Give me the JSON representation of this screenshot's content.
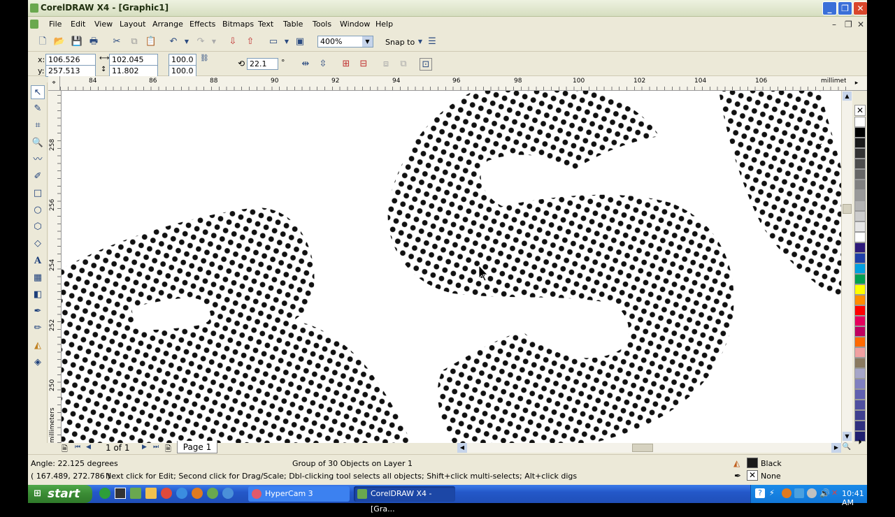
{
  "window": {
    "title": "CorelDRAW X4 - [Graphic1]"
  },
  "menu": [
    "File",
    "Edit",
    "View",
    "Layout",
    "Arrange",
    "Effects",
    "Bitmaps",
    "Text",
    "Table",
    "Tools",
    "Window",
    "Help"
  ],
  "toolbar": {
    "zoom": "400%",
    "snap_to": "Snap to"
  },
  "property_bar": {
    "x_label": "x:",
    "x": "106.526 mm",
    "y_label": "y:",
    "y": "257.513 mm",
    "width": "102.045 mm",
    "height": "11.802 mm",
    "scale_w": "100.0",
    "scale_h": "100.0",
    "angle": "22.1",
    "degree_symbol": "°"
  },
  "rulers": {
    "h_ticks": [
      "84",
      "86",
      "88",
      "90",
      "92",
      "94",
      "96",
      "98",
      "100",
      "102",
      "104",
      "106"
    ],
    "v_ticks": [
      "258",
      "256",
      "254",
      "252",
      "250"
    ],
    "unit": "millimeters"
  },
  "page_nav": {
    "counter": "1 of 1",
    "page_tab": "Page 1"
  },
  "status": {
    "angle": "Angle: 22.125 degrees",
    "object_info": "Group of 30 Objects on Layer 1",
    "coords": "( 167.489, 272.786 )",
    "hint": "Next click for Edit; Second click for Drag/Scale; Dbl-clicking tool selects all objects; Shift+click multi-selects; Alt+click digs",
    "fill": "Black",
    "outline": "None"
  },
  "taskbar": {
    "start": "start",
    "items": [
      "HyperCam 3",
      "CorelDRAW X4 - [Gra..."
    ],
    "clock": "10:41 AM"
  },
  "palette": [
    "#ffffff",
    "#000000",
    "#1a1a1a",
    "#333333",
    "#4d4d4d",
    "#666666",
    "#808080",
    "#999999",
    "#b3b3b3",
    "#cccccc",
    "#e6e6e6",
    "#ffffff",
    "#2e1a7a",
    "#1f3fa8",
    "#00a0e0",
    "#00a050",
    "#ffff00",
    "#ff8c00",
    "#ff0000",
    "#e6005c",
    "#c00060",
    "#ff6a00",
    "#f0a0a0",
    "#8a7a60",
    "#a6a6c8",
    "#8080c0",
    "#6060b0",
    "#5050a0",
    "#404090",
    "#303080",
    "#202070"
  ],
  "colors": {
    "accent_blue": "#2458c9",
    "chrome": "#ECE9D8",
    "start_green": "#3a8b34"
  }
}
